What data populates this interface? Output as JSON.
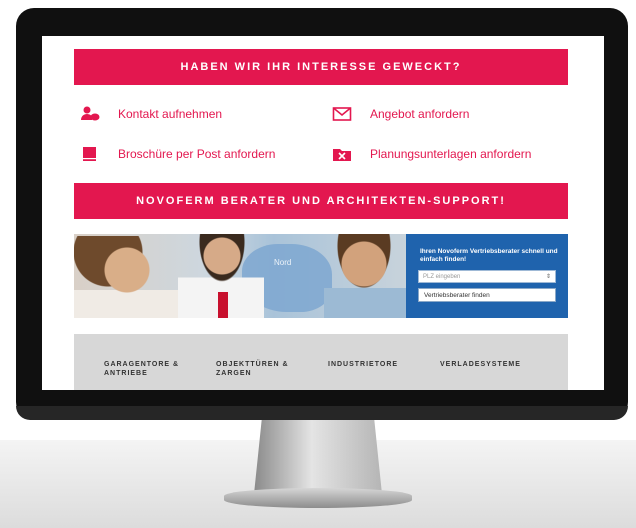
{
  "banner_top": "HABEN WIR IHR INTERESSE GEWECKT?",
  "contacts": [
    {
      "label": "Kontakt aufnehmen",
      "icon": "person-chat-icon"
    },
    {
      "label": "Angebot anfordern",
      "icon": "envelope-icon"
    },
    {
      "label": "Broschüre per Post anfordern",
      "icon": "book-icon"
    },
    {
      "label": "Planungsunterlagen anfordern",
      "icon": "folder-tools-icon"
    }
  ],
  "banner_support": "NOVOFERM BERATER UND ARCHITEKTEN-SUPPORT!",
  "photo_map_label": "Nord",
  "search": {
    "title": "Ihren Novoferm Vertriebsberater schnell und einfach finden!",
    "zip_placeholder": "PLZ eingeben",
    "button_label": "Vertriebsberater finden"
  },
  "categories": [
    "GARAGENTORE & ANTRIEBE",
    "OBJEKTTÜREN & ZARGEN",
    "INDUSTRIETORE",
    "VERLADESYSTEME"
  ],
  "colors": {
    "accent": "#e3174f",
    "search_panel": "#1f63ad",
    "category_bar": "#d7d7d7"
  }
}
